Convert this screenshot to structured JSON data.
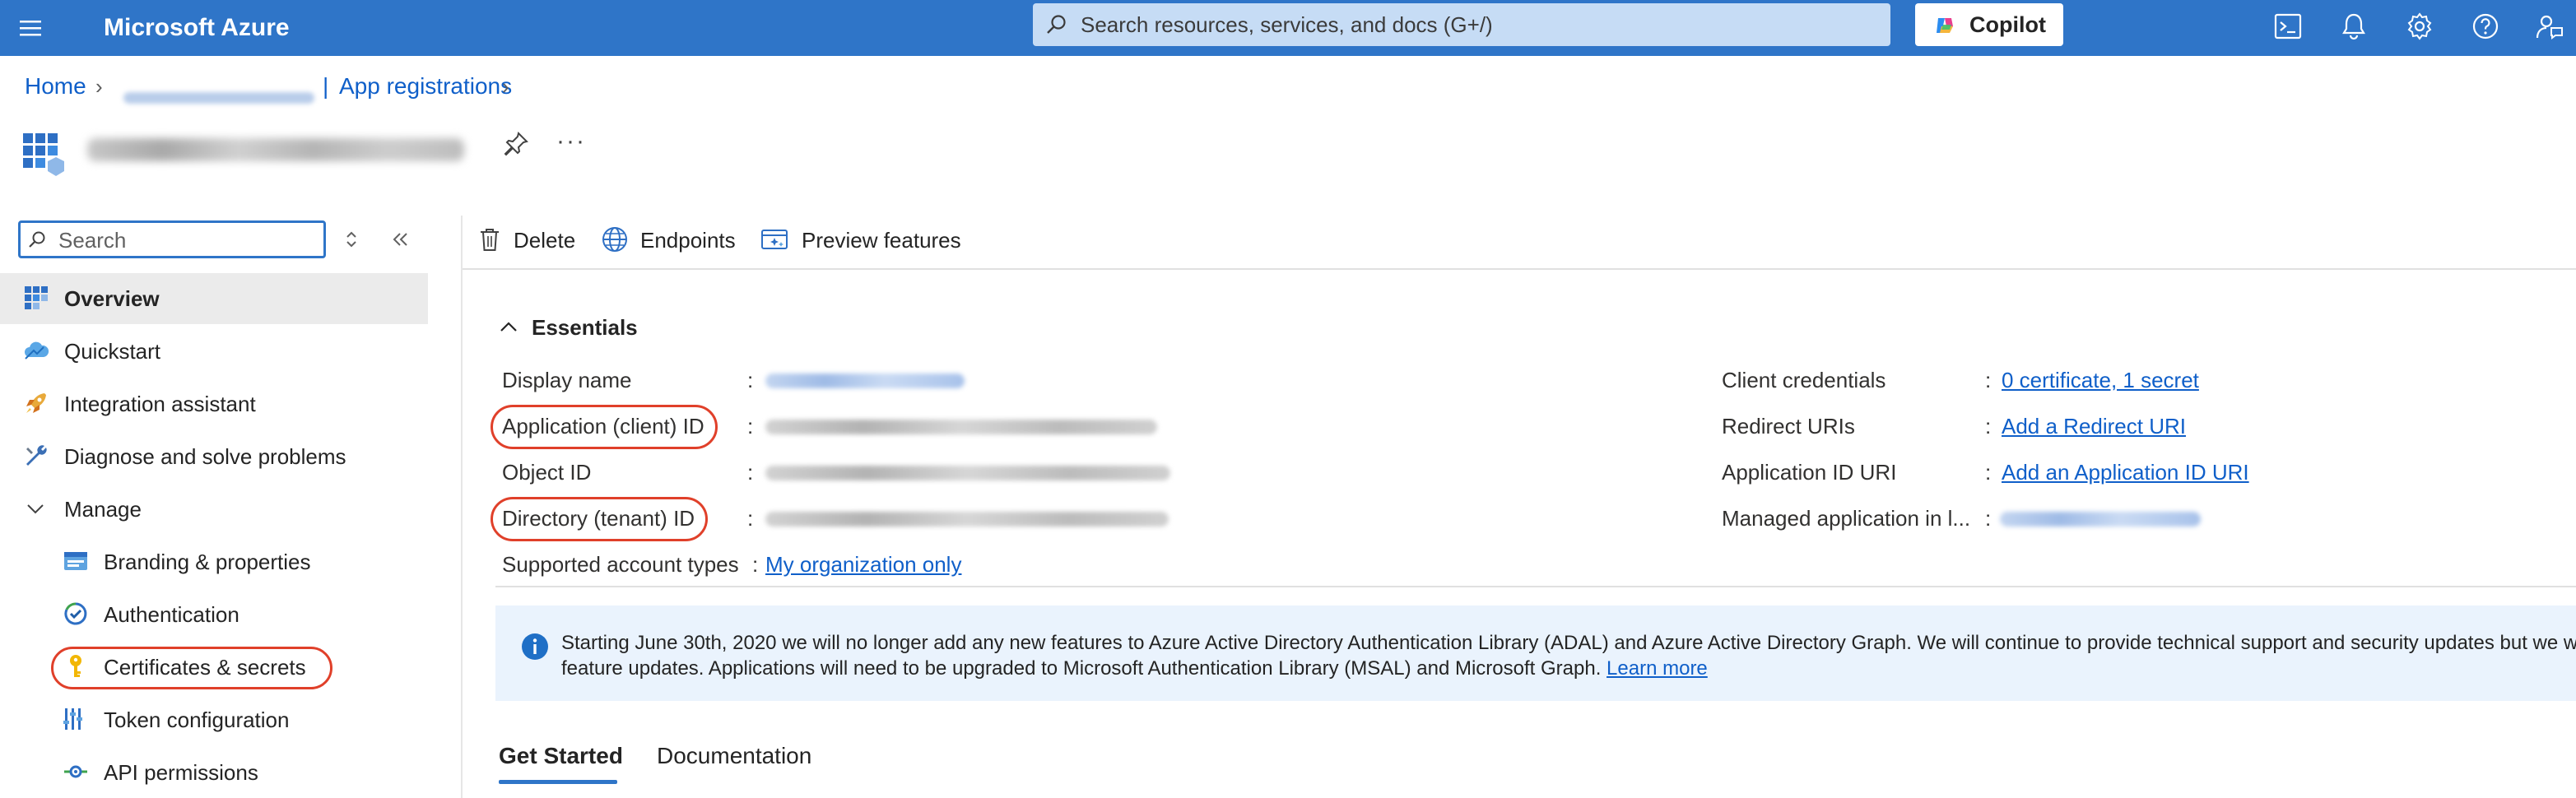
{
  "app": {
    "brand": "Microsoft Azure"
  },
  "topbar": {
    "search_placeholder": "Search resources, services, and docs (G+/)",
    "copilot_label": "Copilot",
    "icons": [
      "menu-icon",
      "cloud-shell-icon",
      "bell-icon",
      "gear-icon",
      "help-icon",
      "feedback-icon"
    ]
  },
  "breadcrumb": {
    "home": "Home",
    "current": "App registrations"
  },
  "toolbar_icons": [
    "pin-icon",
    "more-icon"
  ],
  "nav": {
    "search_placeholder": "Search",
    "items": [
      {
        "label": "Overview",
        "icon": "overview-grid-icon",
        "selected": true
      },
      {
        "label": "Quickstart",
        "icon": "cloud-icon"
      },
      {
        "label": "Integration assistant",
        "icon": "rocket-icon"
      },
      {
        "label": "Diagnose and solve problems",
        "icon": "wrench-icon"
      },
      {
        "label": "Manage",
        "icon": "chevron-down-icon"
      },
      {
        "label": "Branding & properties",
        "icon": "branding-icon"
      },
      {
        "label": "Authentication",
        "icon": "authentication-icon"
      },
      {
        "label": "Certificates & secrets",
        "icon": "key-icon"
      },
      {
        "label": "Token configuration",
        "icon": "token-icon"
      },
      {
        "label": "API permissions",
        "icon": "api-permissions-icon"
      }
    ]
  },
  "commands": [
    {
      "label": "Delete",
      "icon": "trash-icon"
    },
    {
      "label": "Endpoints",
      "icon": "globe-icon"
    },
    {
      "label": "Preview features",
      "icon": "preview-icon"
    }
  ],
  "essentials": {
    "title": "Essentials",
    "left": [
      {
        "label": "Display name"
      },
      {
        "label": "Application (client) ID"
      },
      {
        "label": "Object ID"
      },
      {
        "label": "Directory (tenant) ID"
      },
      {
        "label": "Supported account types",
        "value": "My organization only"
      }
    ],
    "right": [
      {
        "label": "Client credentials",
        "value": "0 certificate, 1 secret"
      },
      {
        "label": "Redirect URIs",
        "value": "Add a Redirect URI"
      },
      {
        "label": "Application ID URI",
        "value": "Add an Application ID URI"
      },
      {
        "label": "Managed application in l..."
      }
    ]
  },
  "banner": {
    "line1": "Starting June 30th, 2020 we will no longer add any new features to Azure Active Directory Authentication Library (ADAL) and Azure Active Directory Graph. We will continue to provide technical support and security updates but we w",
    "line2": "feature updates. Applications will need to be upgraded to Microsoft Authentication Library (MSAL) and Microsoft Graph.",
    "link": "Learn more"
  },
  "tabs": [
    {
      "label": "Get Started",
      "active": true
    },
    {
      "label": "Documentation"
    }
  ],
  "colors": {
    "topbar": "#2f75c8",
    "link": "#0f5fc9",
    "highlight": "#e0402a",
    "banner": "#eaf3fd"
  }
}
